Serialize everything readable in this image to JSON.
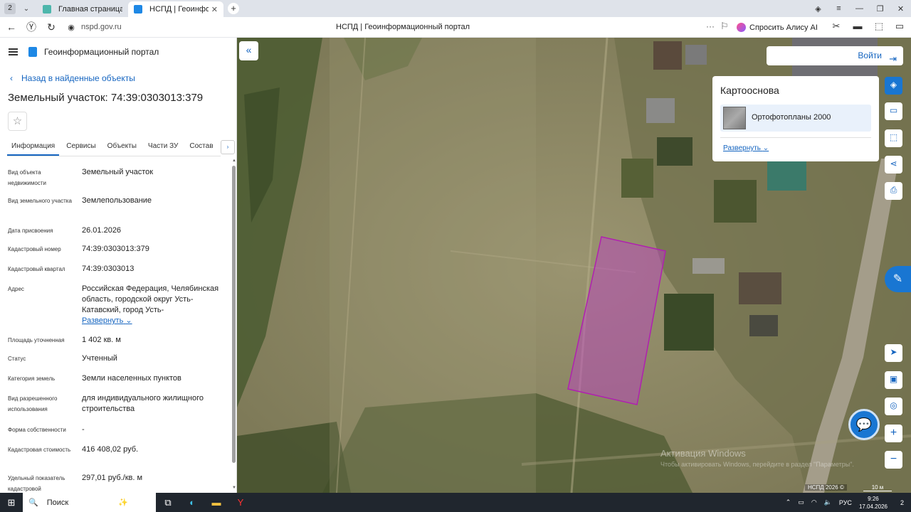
{
  "browser": {
    "tab_count": "2",
    "tabs": [
      {
        "title": "Главная страница",
        "favicon_color": "#4db6ac"
      },
      {
        "title": "НСПД | Геоинформац",
        "favicon_color": "#1e88e5"
      }
    ],
    "url": "nspd.gov.ru",
    "page_title": "НСПД | Геоинформационный портал",
    "alice_label": "Спросить Алису AI"
  },
  "panel": {
    "brand": "Геоинформационный портал",
    "back_link": "Назад в найденные объекты",
    "object_title": "Земельный участок: 74:39:0303013:379",
    "tabs": [
      "Информация",
      "Сервисы",
      "Объекты",
      "Части ЗУ",
      "Состав"
    ],
    "tabs_more": "›",
    "properties": [
      {
        "label": "Вид объекта недвижимости",
        "value": "Земельный участок"
      },
      {
        "label": "Вид земельного участка",
        "value": "Землепользование"
      },
      {
        "label": "Дата присвоения",
        "value": "26.01.2026"
      },
      {
        "label": "Кадастровый номер",
        "value": "74:39:0303013:379"
      },
      {
        "label": "Кадастровый квартал",
        "value": "74:39:0303013"
      },
      {
        "label": "Адрес",
        "value": "Российская Федерация, Челябинская область, городской округ Усть-Катавский, город Усть-",
        "expand": "Развернуть"
      },
      {
        "label": "Площадь уточненная",
        "value": "1 402 кв. м"
      },
      {
        "label": "Статус",
        "value": "Учтенный"
      },
      {
        "label": "Категория земель",
        "value": "Земли населенных пунктов"
      },
      {
        "label": "Вид разрешенного использования",
        "value": "для индивидуального жилищного строительства"
      },
      {
        "label": "Форма собственности",
        "value": "-"
      },
      {
        "label": "Кадастровая стоимость",
        "value": "416 408,02 руб."
      },
      {
        "label": "Удельный показатель кадастровой",
        "value": "297,01 руб./кв. м"
      }
    ]
  },
  "map": {
    "login_label": "Войти",
    "basemap_title": "Картооснова",
    "basemap_layer": "Ортофотопланы 2000",
    "basemap_expand": "Развернуть",
    "watermark_line1": "Активация Windows",
    "watermark_line2": "Чтобы активировать Windows, перейдите в раздел \"Параметры\".",
    "copyright": "НСПД 2026 ©",
    "scale": "10 м",
    "parcel_color": "#b020b0"
  },
  "taskbar": {
    "search_label": "Поиск",
    "lang": "РУС",
    "time": "9:26",
    "date": "17.04.2026",
    "notifications": "2"
  }
}
